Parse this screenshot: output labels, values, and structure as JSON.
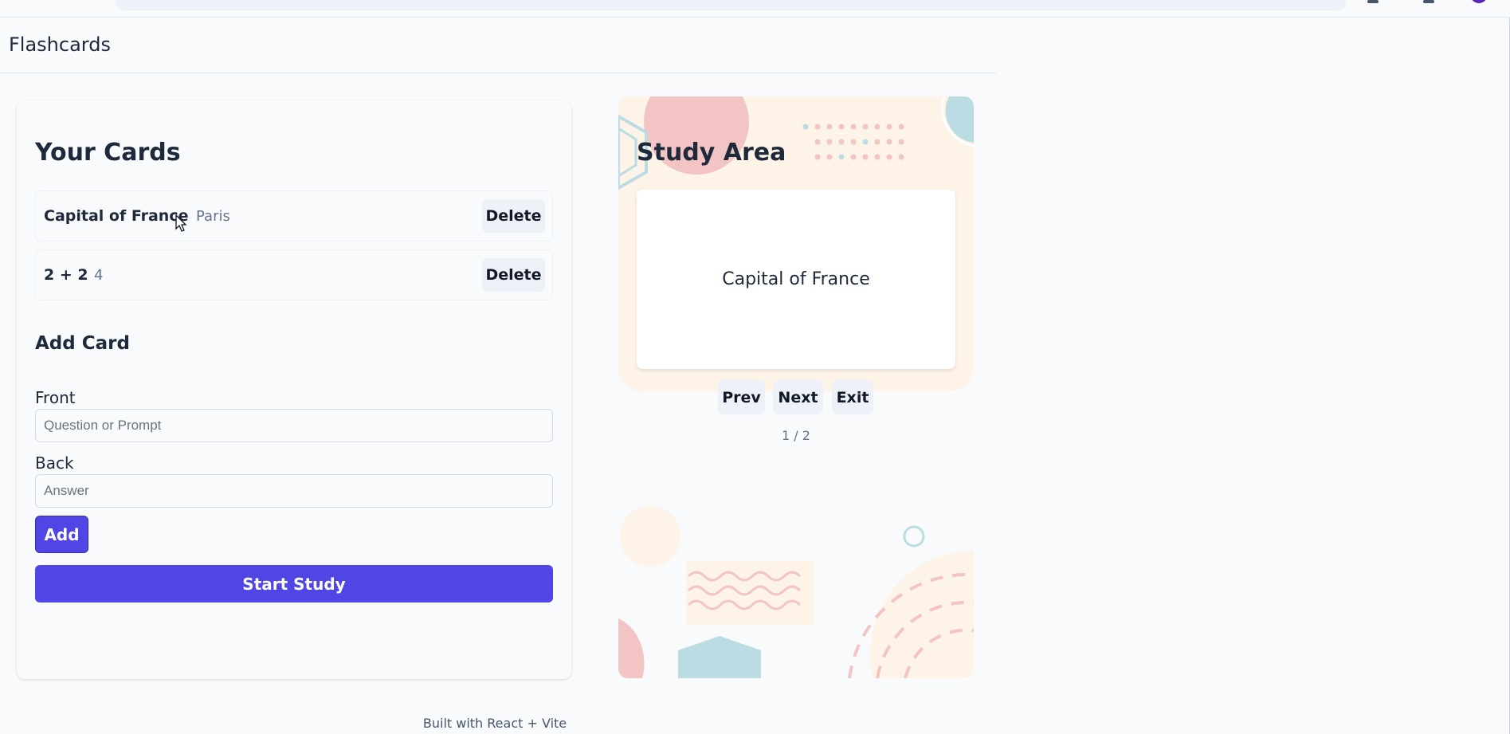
{
  "header": {
    "brand": "Flashcards"
  },
  "cards_panel": {
    "title": "Your Cards",
    "cards": [
      {
        "front": "Capital of France",
        "back": "Paris",
        "delete_label": "Delete"
      },
      {
        "front": "2 + 2",
        "back": "4",
        "delete_label": "Delete"
      }
    ]
  },
  "add_card": {
    "title": "Add Card",
    "front_label": "Front",
    "front_placeholder": "Question or Prompt",
    "back_label": "Back",
    "back_placeholder": "Answer",
    "add_label": "Add",
    "start_label": "Start Study"
  },
  "study": {
    "title": "Study Area",
    "card_text": "Capital of France",
    "prev_label": "Prev",
    "next_label": "Next",
    "exit_label": "Exit",
    "counter": "1 / 2"
  },
  "footer": {
    "text": "Built with React + Vite"
  },
  "colors": {
    "accent": "#4f46e5",
    "deco_pink": "#f2c4c4",
    "deco_blue": "#bcdce3",
    "deco_cream": "#fdf3e7"
  }
}
